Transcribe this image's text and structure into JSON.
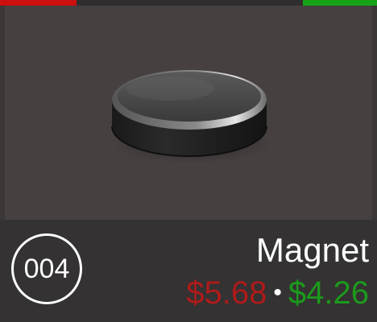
{
  "colors": {
    "top_left_indicator": "#cc0f0f",
    "top_right_indicator": "#17a317",
    "buy_price": "#b01a1a",
    "sell_price": "#1c9a1c"
  },
  "item": {
    "number": "004",
    "name": "Magnet",
    "icon": "magnet-disc-icon",
    "buy_price": "$5.68",
    "separator": "•",
    "sell_price": "$4.26"
  }
}
